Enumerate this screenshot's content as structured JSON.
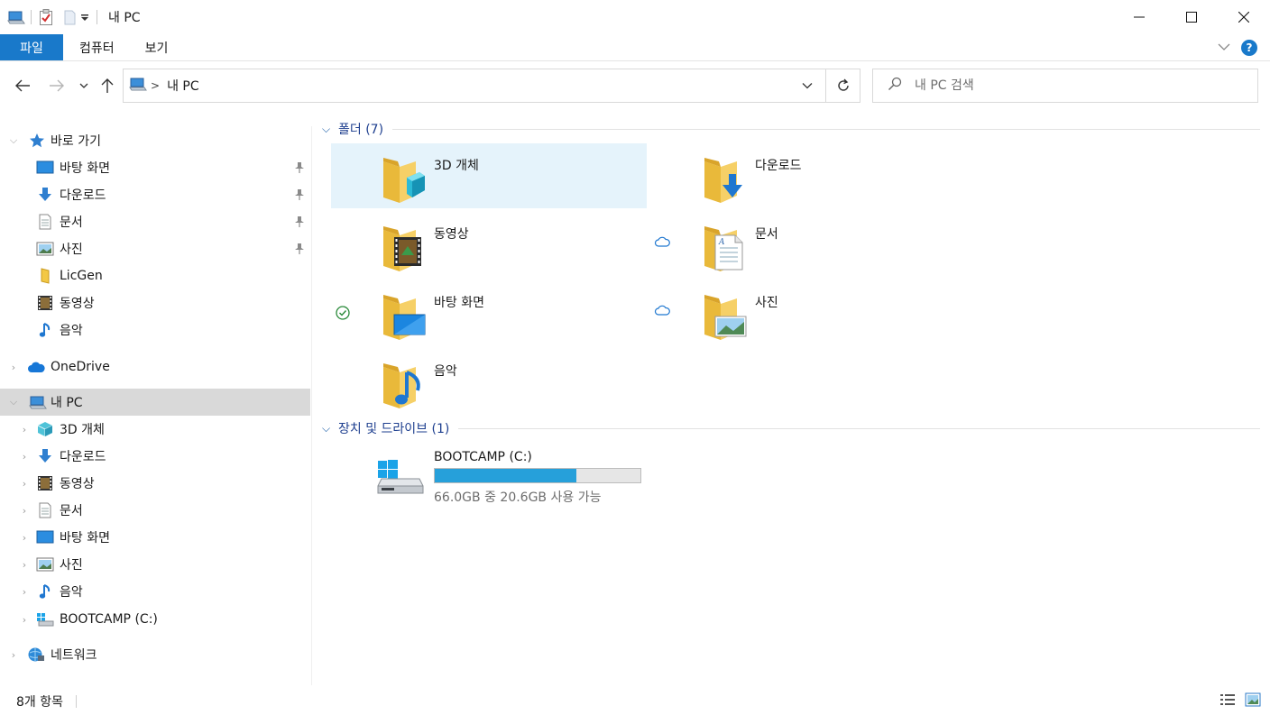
{
  "window": {
    "title": "내 PC",
    "controls": {
      "minimize": "minimize",
      "maximize": "maximize",
      "close": "close"
    }
  },
  "ribbon": {
    "tabs": [
      {
        "label": "파일"
      },
      {
        "label": "컴퓨터"
      },
      {
        "label": "보기"
      }
    ],
    "help_label": "?"
  },
  "address": {
    "crumb": "내 PC",
    "separator": ">",
    "search_placeholder": "내 PC 검색"
  },
  "sidebar": {
    "quick_access": {
      "label": "바로 가기"
    },
    "quick_items": [
      {
        "label": "바탕 화면",
        "pinned": true
      },
      {
        "label": "다운로드",
        "pinned": true
      },
      {
        "label": "문서",
        "pinned": true
      },
      {
        "label": "사진",
        "pinned": true
      },
      {
        "label": "LicGen",
        "pinned": false
      },
      {
        "label": "동영상",
        "pinned": false
      },
      {
        "label": "음악",
        "pinned": false
      }
    ],
    "onedrive": {
      "label": "OneDrive"
    },
    "this_pc": {
      "label": "내 PC"
    },
    "pc_items": [
      {
        "label": "3D 개체"
      },
      {
        "label": "다운로드"
      },
      {
        "label": "동영상"
      },
      {
        "label": "문서"
      },
      {
        "label": "바탕 화면"
      },
      {
        "label": "사진"
      },
      {
        "label": "음악"
      },
      {
        "label": "BOOTCAMP (C:)"
      }
    ],
    "network": {
      "label": "네트워크"
    }
  },
  "content": {
    "folders_group": "폴더 (7)",
    "folders": [
      {
        "label": "3D 개체",
        "icon": "3d-objects-icon"
      },
      {
        "label": "다운로드",
        "icon": "downloads-icon"
      },
      {
        "label": "동영상",
        "icon": "videos-icon"
      },
      {
        "label": "문서",
        "icon": "documents-icon"
      },
      {
        "label": "바탕 화면",
        "icon": "desktop-icon"
      },
      {
        "label": "사진",
        "icon": "pictures-icon"
      },
      {
        "label": "음악",
        "icon": "music-icon"
      }
    ],
    "drives_group": "장치 및 드라이브 (1)",
    "drive": {
      "name": "BOOTCAMP (C:)",
      "used_fraction": 0.688,
      "free_text": "66.0GB 중 20.6GB 사용 가능"
    }
  },
  "statusbar": {
    "item_count": "8개 항목"
  },
  "colors": {
    "accent": "#1979ca",
    "selection": "#e5f3fb",
    "nav_selected": "#d9d9d9",
    "group_header": "#1e3f8f",
    "drive_fill": "#26a0da",
    "folder_yellow": "#f3c845"
  }
}
